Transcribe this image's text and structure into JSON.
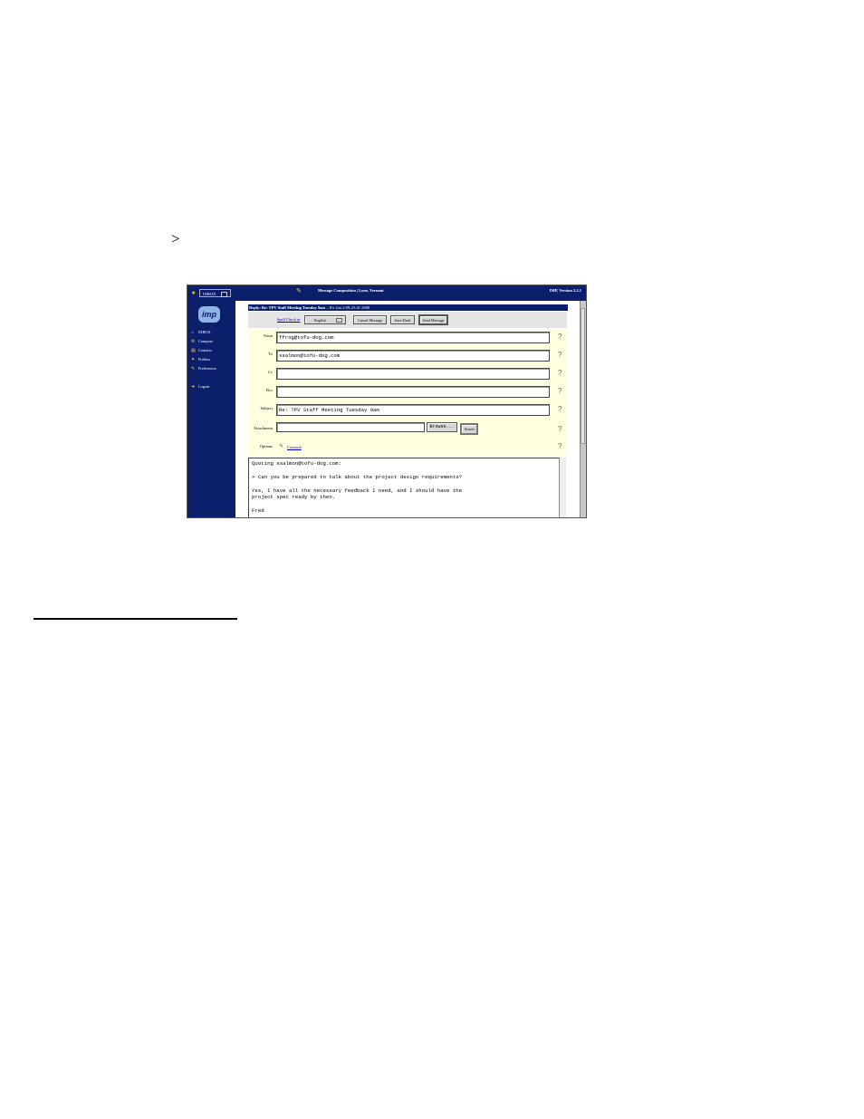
{
  "doc": {
    "gt_symbol": ">"
  },
  "topbar": {
    "folder_select": "INBOX",
    "title": "Message Composition  |  Lone, Vernant",
    "version": "IMP, Version 2.2.1"
  },
  "sidebar": {
    "logo": "imp",
    "items": [
      {
        "label": "INBOX"
      },
      {
        "label": "Compose"
      },
      {
        "label": "Contacts"
      },
      {
        "label": "Folders"
      },
      {
        "label": "Preferences"
      },
      {
        "label": "Logout"
      }
    ]
  },
  "reply_bar": {
    "prefix": "Reply: Re: TPV Staff Meeting Tuesday 9am",
    "date": " – Fri Jun 2 09:23:41 2000"
  },
  "toolbar": {
    "spell_check_link": "Spell Check in",
    "language": "English",
    "cancel_label": "Cancel Message",
    "save_draft_label": "Save Draft",
    "send_label": "Send Message"
  },
  "fields": {
    "from": {
      "label": "From",
      "value": "ffrog@tofu-dog.com"
    },
    "to": {
      "label": "To",
      "value": "ssalmon@tofu-dog.com"
    },
    "cc": {
      "label": "Cc",
      "value": ""
    },
    "bcc": {
      "label": "Bcc",
      "value": ""
    },
    "subject": {
      "label": "Subject",
      "value": "Re: TPV Staff Meeting Tuesday 9am"
    },
    "attachment": {
      "label": "Attachment",
      "value": "",
      "browse_label": "Browse...",
      "attach_label": "Attach"
    },
    "options": {
      "label": "Options",
      "contacts_link": "Contacts"
    }
  },
  "help_glyph": "?",
  "message_body": "Quoting ssalmon@tofu-dog.com:\n\n> Can you be prepared to talk about the project design requirements?\n\nYes, I have all the necessary feedback I need, and I should have the\nproject spec ready by then.\n\nFred"
}
